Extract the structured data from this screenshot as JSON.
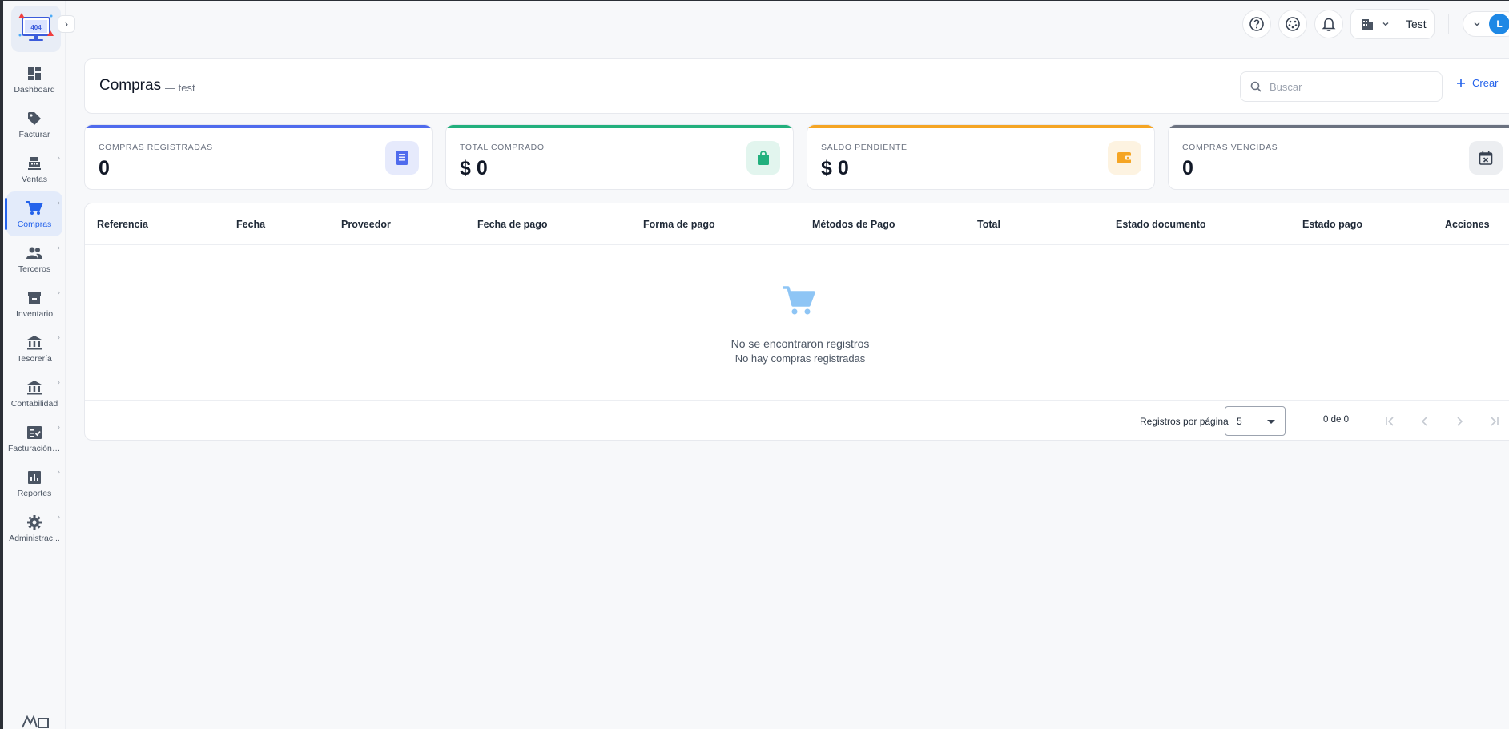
{
  "sidebar": {
    "items": [
      {
        "label": "Dashboard",
        "icon": "dashboard-icon",
        "has_submenu": false
      },
      {
        "label": "Facturar",
        "icon": "tag-icon",
        "has_submenu": false
      },
      {
        "label": "Ventas",
        "icon": "cash-register-icon",
        "has_submenu": true
      },
      {
        "label": "Compras",
        "icon": "cart-icon",
        "has_submenu": true,
        "active": true
      },
      {
        "label": "Terceros",
        "icon": "people-icon",
        "has_submenu": true
      },
      {
        "label": "Inventario",
        "icon": "archive-icon",
        "has_submenu": true
      },
      {
        "label": "Tesorería",
        "icon": "bank-icon",
        "has_submenu": true
      },
      {
        "label": "Contabilidad",
        "icon": "bank-icon",
        "has_submenu": true
      },
      {
        "label": "Facturación ...",
        "icon": "checklist-icon",
        "has_submenu": true
      },
      {
        "label": "Reportes",
        "icon": "chart-icon",
        "has_submenu": true
      },
      {
        "label": "Administrac...",
        "icon": "gear-icon",
        "has_submenu": true
      }
    ]
  },
  "topbar": {
    "company_name": "Test",
    "user_initial": "L"
  },
  "header": {
    "title": "Compras",
    "subtitle": "— test",
    "search_placeholder": "Buscar",
    "create_label": "Crear"
  },
  "stats": [
    {
      "label": "COMPRAS REGISTRADAS",
      "value": "0",
      "accent": "#4f6bed",
      "icon": "receipt-icon"
    },
    {
      "label": "TOTAL COMPRADO",
      "value": "$ 0",
      "accent": "#22b07d",
      "icon": "shopping-bag-icon"
    },
    {
      "label": "SALDO PENDIENTE",
      "value": "$ 0",
      "accent": "#f5a524",
      "icon": "wallet-icon"
    },
    {
      "label": "COMPRAS VENCIDAS",
      "value": "0",
      "accent": "#6b7280",
      "icon": "calendar-x-icon"
    }
  ],
  "table": {
    "columns": [
      "Referencia",
      "Fecha",
      "Proveedor",
      "Fecha de pago",
      "Forma de pago",
      "Métodos de Pago",
      "Total",
      "Estado documento",
      "Estado pago",
      "Acciones"
    ],
    "empty_title": "No se encontraron registros",
    "empty_subtitle": "No hay compras registradas",
    "rows_per_page_label": "Registros por página",
    "rows_per_page_value": "5",
    "range_text": "0 de 0"
  },
  "colors": {
    "primary": "#2563eb",
    "empty_icon": "#8ec5f5"
  }
}
